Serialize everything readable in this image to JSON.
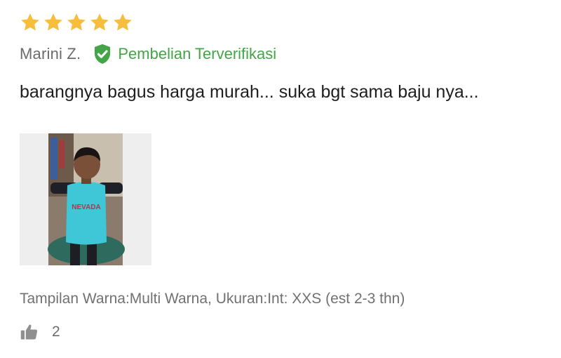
{
  "review": {
    "rating": 5,
    "max_rating": 5,
    "star_color": "#F6BE3B",
    "author": "Marini Z.",
    "verified_label": "Pembelian Terverifikasi",
    "verified_color": "#43A547",
    "text": "barangnya bagus harga murah... suka bgt sama baju nya...",
    "photo": {
      "description_icon": "review-photo-child-in-shirt",
      "shirt_text": "NEVADA"
    },
    "variant": "Tampilan Warna:Multi Warna, Ukuran:Int: XXS (est 2-3 thn)",
    "helpful_count": "2"
  },
  "icons": {
    "star": "star-icon",
    "verified": "shield-check-icon",
    "like": "thumbs-up-icon"
  }
}
